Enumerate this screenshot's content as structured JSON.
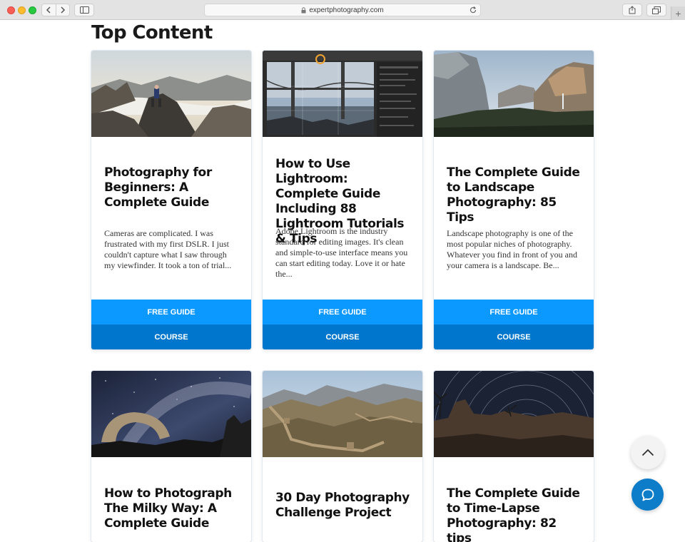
{
  "browser": {
    "url": "expertphotography.com"
  },
  "page": {
    "title": "Top Content"
  },
  "cards": [
    {
      "title": "Photography for Beginners: A Complete Guide",
      "description": "Cameras are complicated. I was frustrated with my first DSLR. I just couldn't capture what I saw through my viewfinder. It took a ton of trial...",
      "free_guide_label": "FREE GUIDE",
      "course_label": "COURSE"
    },
    {
      "title": "How to Use Lightroom: Complete Guide Including 88 Lightroom Tutorials & Tips",
      "description": "Adobe Lightroom is the industry standard for editing images. It's clean and simple-to-use interface means you can start editing today. Love it or hate the...",
      "free_guide_label": "FREE GUIDE",
      "course_label": "COURSE"
    },
    {
      "title": "The Complete Guide to Landscape Photography: 85 Tips",
      "description": "Landscape photography is one of the most popular niches of photography. Whatever you find in front of you and your camera is a landscape. Be...",
      "free_guide_label": "FREE GUIDE",
      "course_label": "COURSE"
    },
    {
      "title": "How to Photograph The Milky Way: A Complete Guide"
    },
    {
      "title": "30 Day Photography Challenge Project"
    },
    {
      "title": "The Complete Guide to Time-Lapse Photography: 82 tips"
    }
  ],
  "colors": {
    "free_guide_button": "#0c99ff",
    "course_button": "#0077cc",
    "chat_button": "#0d7cc9"
  },
  "icons": {
    "scroll_top": "chevron-up-icon",
    "chat": "chat-bubble-icon"
  }
}
